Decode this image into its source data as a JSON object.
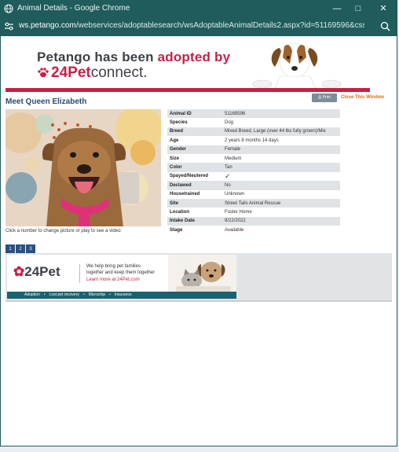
{
  "window": {
    "title": "Animal Details - Google Chrome",
    "url_host": "ws.petango.com",
    "url_rest": "/webservices/adoptablesearch/wsAdoptableAnimalDetails2.aspx?id=51169596&css=..."
  },
  "banner": {
    "line1_prefix": "Petango has been ",
    "line1_accent": "adopted by",
    "brand_number": "24",
    "brand_pet": "Pet",
    "brand_rest": "connect."
  },
  "page": {
    "title": "Meet Queen Elizabeth",
    "print_label": "Print",
    "close_label": "Close This Window",
    "caption": "Click a number to change picture or play to see a video:",
    "photo_numbers": [
      "1",
      "2",
      "3"
    ]
  },
  "details": [
    {
      "label": "Animal ID",
      "value": "51169596"
    },
    {
      "label": "Species",
      "value": "Dog"
    },
    {
      "label": "Breed",
      "value": "Mixed Breed, Large (over 44 lbs fully grown)/Mix"
    },
    {
      "label": "Age",
      "value": "2 years 8 months 14 days"
    },
    {
      "label": "Gender",
      "value": "Female"
    },
    {
      "label": "Size",
      "value": "Medium"
    },
    {
      "label": "Color",
      "value": "Tan"
    },
    {
      "label": "Spayed/Neutered",
      "value": "✓"
    },
    {
      "label": "Declawed",
      "value": "No"
    },
    {
      "label": "Housetrained",
      "value": "Unknown"
    },
    {
      "label": "Site",
      "value": "Street Tails Animal Rescue"
    },
    {
      "label": "Location",
      "value": "Foster Home"
    },
    {
      "label": "Intake Date",
      "value": "9/22/2022"
    },
    {
      "label": "Stage",
      "value": "Available"
    }
  ],
  "promo": {
    "logo_text": "24Pet",
    "line1": "We help bring pet families",
    "line2": "together and keep them together",
    "line3": "Learn more at 24Pet.com",
    "services": [
      "Adoption",
      "•",
      "Lost pet recovery",
      "•",
      "Microchip",
      "•",
      "Insurance"
    ]
  },
  "colors": {
    "chrome_bar": "#1f5c5b",
    "brand_red": "#c91f45",
    "title_blue": "#2b4a73",
    "button_blue": "#2c4e80",
    "close_orange": "#e06a1a"
  }
}
